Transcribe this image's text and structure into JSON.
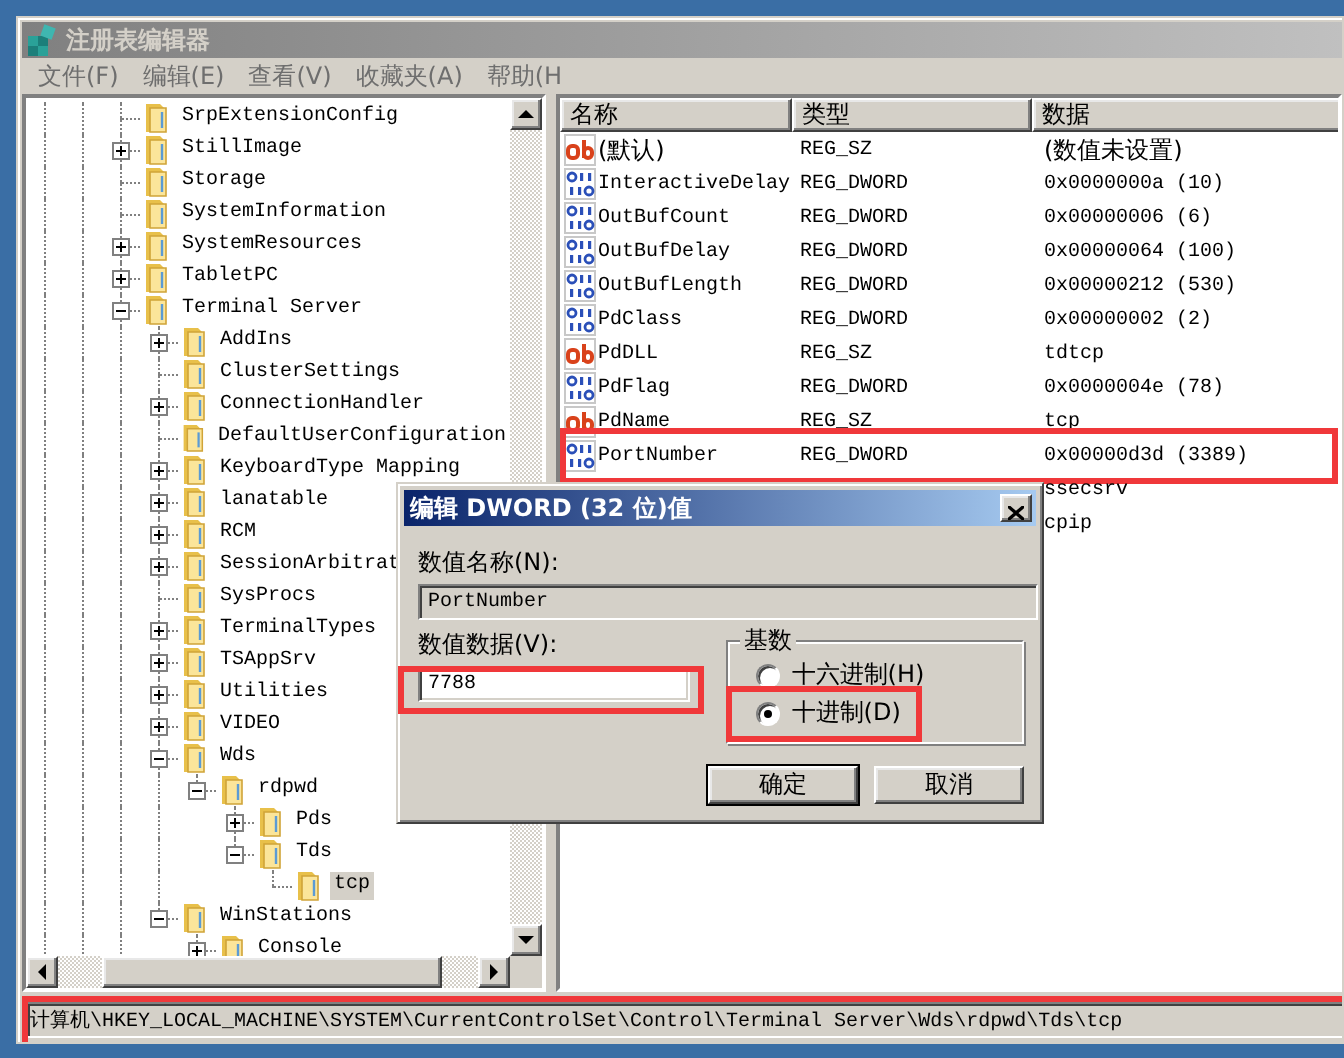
{
  "window": {
    "title": "注册表编辑器"
  },
  "menu": [
    {
      "label": "文件(F)"
    },
    {
      "label": "编辑(E)"
    },
    {
      "label": "查看(V)"
    },
    {
      "label": "收藏夹(A)"
    },
    {
      "label": "帮助(H"
    }
  ],
  "tree": [
    {
      "label": "SrpExtensionConfig",
      "selected": false
    },
    {
      "label": "StillImage",
      "expanded": false,
      "selected": false
    },
    {
      "label": "Storage",
      "selected": false
    },
    {
      "label": "SystemInformation",
      "selected": false
    },
    {
      "label": "SystemResources",
      "expanded": false,
      "selected": false
    },
    {
      "label": "TabletPC",
      "expanded": false,
      "selected": false
    },
    {
      "label": "Terminal Server",
      "expanded": true,
      "selected": false,
      "children": [
        {
          "label": "AddIns",
          "expanded": false,
          "selected": false
        },
        {
          "label": "ClusterSettings",
          "selected": false
        },
        {
          "label": "ConnectionHandler",
          "expanded": false,
          "selected": false
        },
        {
          "label": "DefaultUserConfiguration",
          "selected": false
        },
        {
          "label": "KeyboardType Mapping",
          "expanded": false,
          "selected": false
        },
        {
          "label": "lanatable",
          "expanded": false,
          "selected": false
        },
        {
          "label": "RCM",
          "expanded": false,
          "selected": false
        },
        {
          "label": "SessionArbitrat",
          "expanded": false,
          "selected": false
        },
        {
          "label": "SysProcs",
          "selected": false
        },
        {
          "label": "TerminalTypes",
          "expanded": false,
          "selected": false
        },
        {
          "label": "TSAppSrv",
          "expanded": false,
          "selected": false
        },
        {
          "label": "Utilities",
          "expanded": false,
          "selected": false
        },
        {
          "label": "VIDEO",
          "expanded": false,
          "selected": false
        },
        {
          "label": "Wds",
          "expanded": true,
          "selected": false,
          "children": [
            {
              "label": "rdpwd",
              "expanded": true,
              "selected": false,
              "children": [
                {
                  "label": "Pds",
                  "expanded": false,
                  "selected": false
                },
                {
                  "label": "Tds",
                  "expanded": true,
                  "selected": false,
                  "children": [
                    {
                      "label": "tcp",
                      "selected": true
                    }
                  ]
                }
              ]
            }
          ]
        },
        {
          "label": "WinStations",
          "expanded": true,
          "selected": false,
          "children": [
            {
              "label": "Console",
              "expanded": false,
              "selected": false
            }
          ]
        }
      ]
    }
  ],
  "list": {
    "columns": [
      "名称",
      "类型",
      "数据"
    ],
    "rows": [
      {
        "kind": "string",
        "name": "(默认)",
        "type": "REG_SZ",
        "data": "(数值未设置)",
        "highlighted": false
      },
      {
        "kind": "dword",
        "name": "InteractiveDelay",
        "type": "REG_DWORD",
        "data": "0x0000000a (10)",
        "highlighted": false
      },
      {
        "kind": "dword",
        "name": "OutBufCount",
        "type": "REG_DWORD",
        "data": "0x00000006 (6)",
        "highlighted": false
      },
      {
        "kind": "dword",
        "name": "OutBufDelay",
        "type": "REG_DWORD",
        "data": "0x00000064 (100)",
        "highlighted": false
      },
      {
        "kind": "dword",
        "name": "OutBufLength",
        "type": "REG_DWORD",
        "data": "0x00000212 (530)",
        "highlighted": false
      },
      {
        "kind": "dword",
        "name": "PdClass",
        "type": "REG_DWORD",
        "data": "0x00000002 (2)",
        "highlighted": false
      },
      {
        "kind": "string",
        "name": "PdDLL",
        "type": "REG_SZ",
        "data": "tdtcp",
        "highlighted": false
      },
      {
        "kind": "dword",
        "name": "PdFlag",
        "type": "REG_DWORD",
        "data": "0x0000004e (78)",
        "highlighted": false
      },
      {
        "kind": "string",
        "name": "PdName",
        "type": "REG_SZ",
        "data": "tcp",
        "highlighted": false
      },
      {
        "kind": "dword",
        "name": "PortNumber",
        "type": "REG_DWORD",
        "data": "0x00000d3d (3389)",
        "highlighted": true
      },
      {
        "data": "ssecsrv",
        "highlighted": false
      },
      {
        "data": "cpip",
        "highlighted": false
      }
    ]
  },
  "dialog": {
    "title": "编辑 DWORD (32 位)值",
    "name_label": "数值名称(N):",
    "name_value": "PortNumber",
    "data_label": "数值数据(V):",
    "data_value": "7788",
    "data_highlighted": true,
    "radix": {
      "label": "基数",
      "options": [
        {
          "label": "十六进制(H)",
          "selected": false,
          "highlighted": false
        },
        {
          "label": "十进制(D)",
          "selected": true,
          "highlighted": true
        }
      ]
    },
    "buttons": [
      "确定",
      "取消"
    ]
  },
  "status_bar": {
    "text": "计算机\\HKEY_LOCAL_MACHINE\\SYSTEM\\CurrentControlSet\\Control\\Terminal Server\\Wds\\rdpwd\\Tds\\tcp",
    "highlighted": true
  }
}
